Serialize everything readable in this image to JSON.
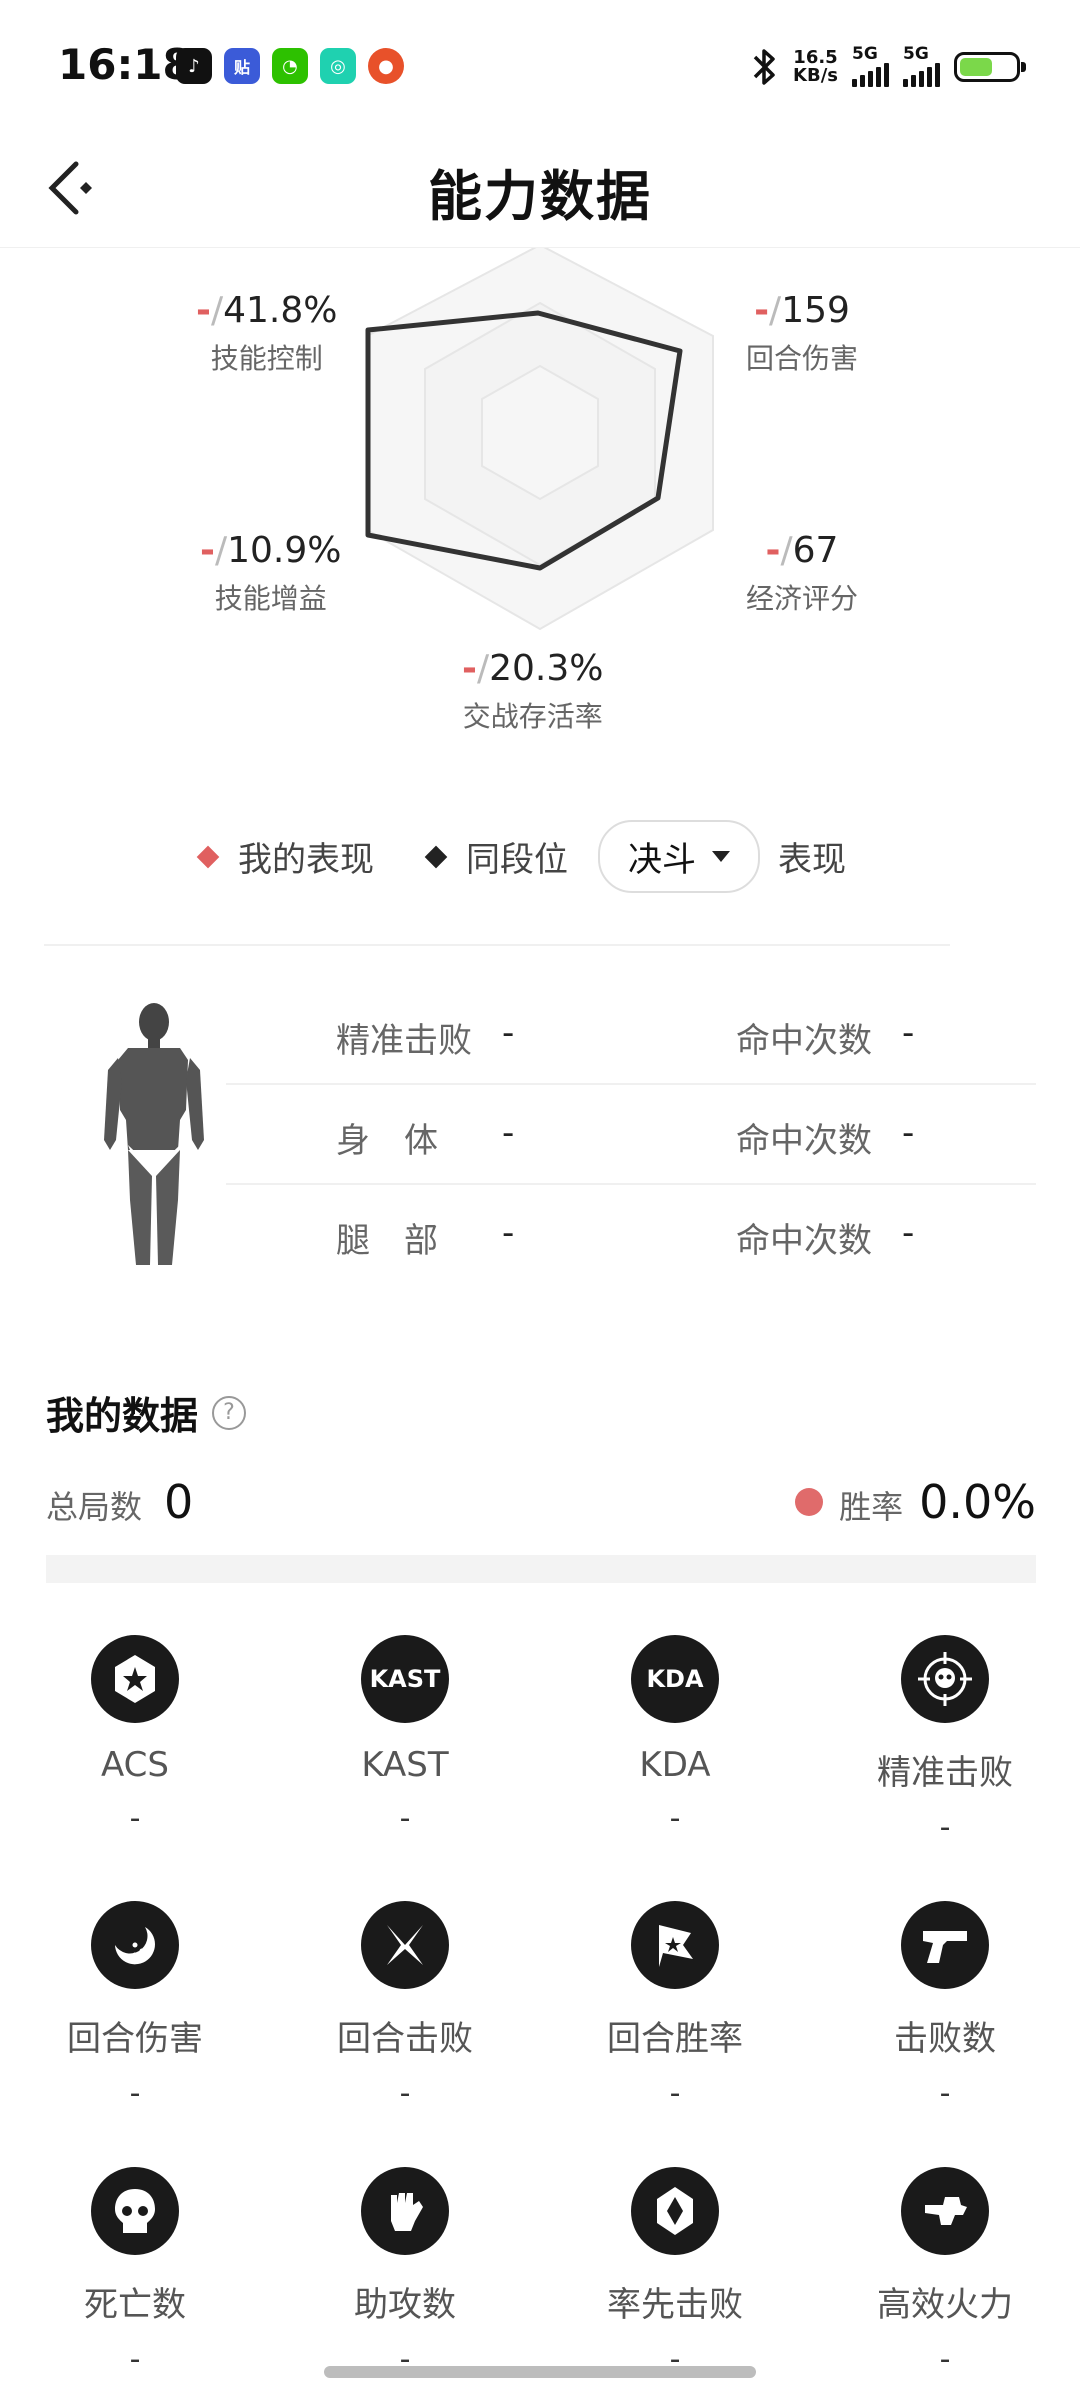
{
  "status_bar": {
    "time": "16:18",
    "app_icons": [
      "music-icon",
      "tieba-icon",
      "wechat-icon",
      "camera-app-icon",
      "weibo-icon"
    ],
    "bluetooth": "bluetooth-icon",
    "net_speed_value": "16.5",
    "net_speed_unit": "KB/s",
    "sim1_label": "5G",
    "sim2_label": "5G",
    "battery_level": 0.6
  },
  "header": {
    "title": "能力数据"
  },
  "radar": {
    "stats": [
      {
        "key": "skill_control",
        "prefix": "-",
        "value": "41.8%",
        "label": "技能控制"
      },
      {
        "key": "round_damage",
        "prefix": "-",
        "value": "159",
        "label": "回合伤害"
      },
      {
        "key": "skill_gain",
        "prefix": "-",
        "value": "10.9%",
        "label": "技能增益"
      },
      {
        "key": "economy",
        "prefix": "-",
        "value": "67",
        "label": "经济评分"
      },
      {
        "key": "survival",
        "prefix": "-",
        "value": "20.3%",
        "label": "交战存活率"
      }
    ],
    "legend_mine": "我的表现",
    "legend_peer": "同段位",
    "mode_selected": "决斗",
    "legend_suffix": "表现",
    "colors": {
      "mine": "#e06060",
      "peer": "#333333"
    }
  },
  "body_hits": {
    "rows": [
      {
        "label": "精准击败",
        "value": "-",
        "label2": "命中次数",
        "value2": "-"
      },
      {
        "label": "身　体",
        "value": "-",
        "label2": "命中次数",
        "value2": "-"
      },
      {
        "label": "腿　部",
        "value": "-",
        "label2": "命中次数",
        "value2": "-"
      }
    ]
  },
  "my_data": {
    "title": "我的数据",
    "help": "?",
    "total_label": "总局数",
    "total_value": "0",
    "winrate_label": "胜率",
    "winrate_value": "0.0%",
    "items": [
      {
        "icon": "star-badge-icon",
        "icon_text": "",
        "label": "ACS",
        "value": "-"
      },
      {
        "icon": "kast-icon",
        "icon_text": "KAST",
        "label": "KAST",
        "value": "-"
      },
      {
        "icon": "kda-icon",
        "icon_text": "KDA",
        "label": "KDA",
        "value": "-"
      },
      {
        "icon": "crosshair-skull-icon",
        "icon_text": "",
        "label": "精准击败",
        "value": "-"
      },
      {
        "icon": "crescent-icon",
        "icon_text": "",
        "label": "回合伤害",
        "value": "-"
      },
      {
        "icon": "crossed-blades-icon",
        "icon_text": "",
        "label": "回合击败",
        "value": "-"
      },
      {
        "icon": "flag-icon",
        "icon_text": "",
        "label": "回合胜率",
        "value": "-"
      },
      {
        "icon": "pistol-icon",
        "icon_text": "",
        "label": "击败数",
        "value": "-"
      },
      {
        "icon": "skull-icon",
        "icon_text": "",
        "label": "死亡数",
        "value": "-"
      },
      {
        "icon": "fist-icon",
        "icon_text": "",
        "label": "助攻数",
        "value": "-"
      },
      {
        "icon": "first-blood-icon",
        "icon_text": "",
        "label": "率先击败",
        "value": "-"
      },
      {
        "icon": "firepower-icon",
        "icon_text": "",
        "label": "高效火力",
        "value": "-"
      }
    ]
  }
}
